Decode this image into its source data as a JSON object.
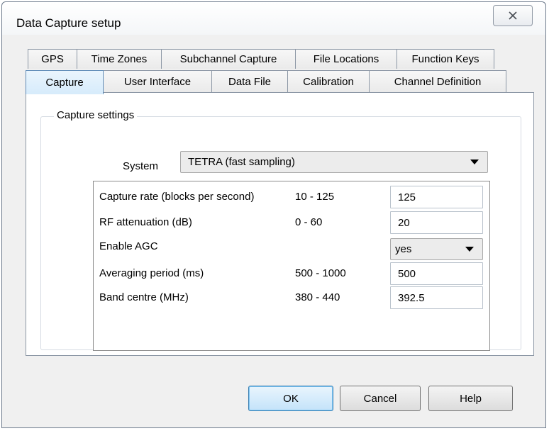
{
  "window": {
    "title": "Data Capture setup"
  },
  "tabs": {
    "back_row": [
      {
        "label": "GPS",
        "width": 70
      },
      {
        "label": "Time Zones",
        "width": 120
      },
      {
        "label": "Subchannel Capture",
        "width": 190
      },
      {
        "label": "File Locations",
        "width": 144
      },
      {
        "label": "Function Keys",
        "width": 138
      }
    ],
    "front_row": [
      {
        "label": "Capture",
        "width": 110
      },
      {
        "label": "User Interface",
        "width": 154
      },
      {
        "label": "Data File",
        "width": 108
      },
      {
        "label": "Calibration",
        "width": 116
      },
      {
        "label": "Channel Definition",
        "width": 194
      }
    ],
    "selected": "Capture"
  },
  "capture_settings": {
    "group_title": "Capture settings",
    "system_label": "System",
    "system_value": "TETRA (fast sampling)",
    "rows": [
      {
        "name": "Capture rate (blocks per second)",
        "range": "10 - 125",
        "value": "125"
      },
      {
        "name": "RF attenuation (dB)",
        "range": "0 - 60",
        "value": "20"
      },
      {
        "name": "Enable AGC",
        "range": "",
        "value": "yes"
      },
      {
        "name": "Averaging period (ms)",
        "range": "500 - 1000",
        "value": "500"
      },
      {
        "name": "Band centre (MHz)",
        "range": "380 - 440",
        "value": "392.5"
      }
    ]
  },
  "buttons": {
    "ok": "OK",
    "cancel": "Cancel",
    "help": "Help"
  },
  "colors": {
    "selected_tab": "#d6ebfb",
    "default_button_border": "#3c7fb1"
  }
}
